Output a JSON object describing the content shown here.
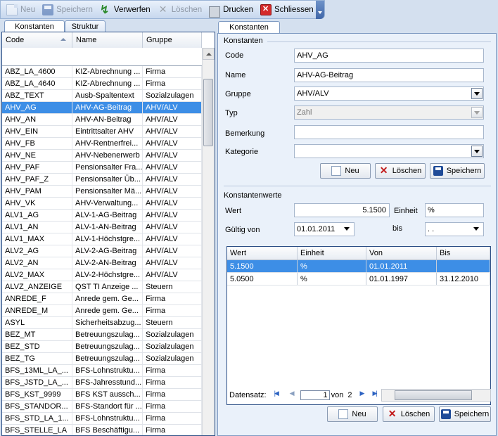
{
  "toolbar": {
    "new_label": "Neu",
    "save_label": "Speichern",
    "discard_label": "Verwerfen",
    "delete_label": "Löschen",
    "print_label": "Drucken",
    "close_label": "Schliessen"
  },
  "left_tabs": [
    "Konstanten",
    "Struktur"
  ],
  "right_tab": "Konstanten",
  "grid": {
    "columns": [
      "Code",
      "Name",
      "Gruppe"
    ],
    "rows": [
      [
        "ABZ_LA_4600",
        "KIZ-Abrechnung ...",
        "Firma"
      ],
      [
        "ABZ_LA_4640",
        "KIZ-Abrechnung ...",
        "Firma"
      ],
      [
        "ABZ_TEXT",
        "Ausb-Spaltentext",
        "Sozialzulagen"
      ],
      [
        "AHV_AG",
        "AHV-AG-Beitrag",
        "AHV/ALV"
      ],
      [
        "AHV_AN",
        "AHV-AN-Beitrag",
        "AHV/ALV"
      ],
      [
        "AHV_EIN",
        "Eintrittsalter AHV",
        "AHV/ALV"
      ],
      [
        "AHV_FB",
        "AHV-Rentnerfrei...",
        "AHV/ALV"
      ],
      [
        "AHV_NE",
        "AHV-Nebenerwerb",
        "AHV/ALV"
      ],
      [
        "AHV_PAF",
        "Pensionsalter Fra...",
        "AHV/ALV"
      ],
      [
        "AHV_PAF_Z",
        "Pensionsalter Üb...",
        "AHV/ALV"
      ],
      [
        "AHV_PAM",
        "Pensionsalter Mä...",
        "AHV/ALV"
      ],
      [
        "AHV_VK",
        "AHV-Verwaltung...",
        "AHV/ALV"
      ],
      [
        "ALV1_AG",
        "ALV-1-AG-Beitrag",
        "AHV/ALV"
      ],
      [
        "ALV1_AN",
        "ALV-1-AN-Beitrag",
        "AHV/ALV"
      ],
      [
        "ALV1_MAX",
        "ALV-1-Höchstgre...",
        "AHV/ALV"
      ],
      [
        "ALV2_AG",
        "ALV-2-AG-Beitrag",
        "AHV/ALV"
      ],
      [
        "ALV2_AN",
        "ALV-2-AN-Beitrag",
        "AHV/ALV"
      ],
      [
        "ALV2_MAX",
        "ALV-2-Höchstgre...",
        "AHV/ALV"
      ],
      [
        "ALVZ_ANZEIGE",
        "QST TI Anzeige ...",
        "Steuern"
      ],
      [
        "ANREDE_F",
        "Anrede gem. Ge...",
        "Firma"
      ],
      [
        "ANREDE_M",
        "Anrede gem. Ge...",
        "Firma"
      ],
      [
        "ASYL",
        "Sicherheitsabzug...",
        "Steuern"
      ],
      [
        "BEZ_MT",
        "Betreuungszulag...",
        "Sozialzulagen"
      ],
      [
        "BEZ_STD",
        "Betreuungszulag...",
        "Sozialzulagen"
      ],
      [
        "BEZ_TG",
        "Betreuungszulag...",
        "Sozialzulagen"
      ],
      [
        "BFS_13ML_LA_...",
        "BFS-Lohnstruktu...",
        "Firma"
      ],
      [
        "BFS_JSTD_LA_...",
        "BFS-Jahresstund...",
        "Firma"
      ],
      [
        "BFS_KST_9999",
        "BFS KST aussch...",
        "Firma"
      ],
      [
        "BFS_STANDOR...",
        "BFS-Standort für ...",
        "Firma"
      ],
      [
        "BFS_STD_LA_1...",
        "BFS-Lohnstruktu...",
        "Firma"
      ],
      [
        "BFS_STELLE_LA",
        "BFS Beschäftigu...",
        "Firma"
      ]
    ],
    "selected_index": 3
  },
  "konstanten": {
    "section_title": "Konstanten",
    "code_label": "Code",
    "code_value": "AHV_AG",
    "name_label": "Name",
    "name_value": "AHV-AG-Beitrag",
    "gruppe_label": "Gruppe",
    "gruppe_value": "AHV/ALV",
    "typ_label": "Typ",
    "typ_value": "Zahl",
    "bemerkung_label": "Bemerkung",
    "bemerkung_value": "",
    "kategorie_label": "Kategorie",
    "kategorie_value": "",
    "new_label": "Neu",
    "delete_label": "Löschen",
    "save_label": "Speichern"
  },
  "werte": {
    "section_title": "Konstantenwerte",
    "wert_label": "Wert",
    "wert_value": "5.1500",
    "einheit_label": "Einheit",
    "einheit_value": "%",
    "gueltig_label": "Gültig von",
    "gueltig_value": "01.01.2011",
    "bis_label": "bis",
    "bis_value": " .  .",
    "columns": [
      "Wert",
      "Einheit",
      "Von",
      "Bis"
    ],
    "rows": [
      [
        "5.1500",
        "%",
        "01.01.2011",
        ""
      ],
      [
        "5.0500",
        "%",
        "01.01.1997",
        "31.12.2010"
      ]
    ],
    "nav_label": "Datensatz:",
    "page_value": "1",
    "page_of": "von",
    "page_total": "2",
    "new_label": "Neu",
    "delete_label": "Löschen",
    "save_label": "Speichern"
  }
}
